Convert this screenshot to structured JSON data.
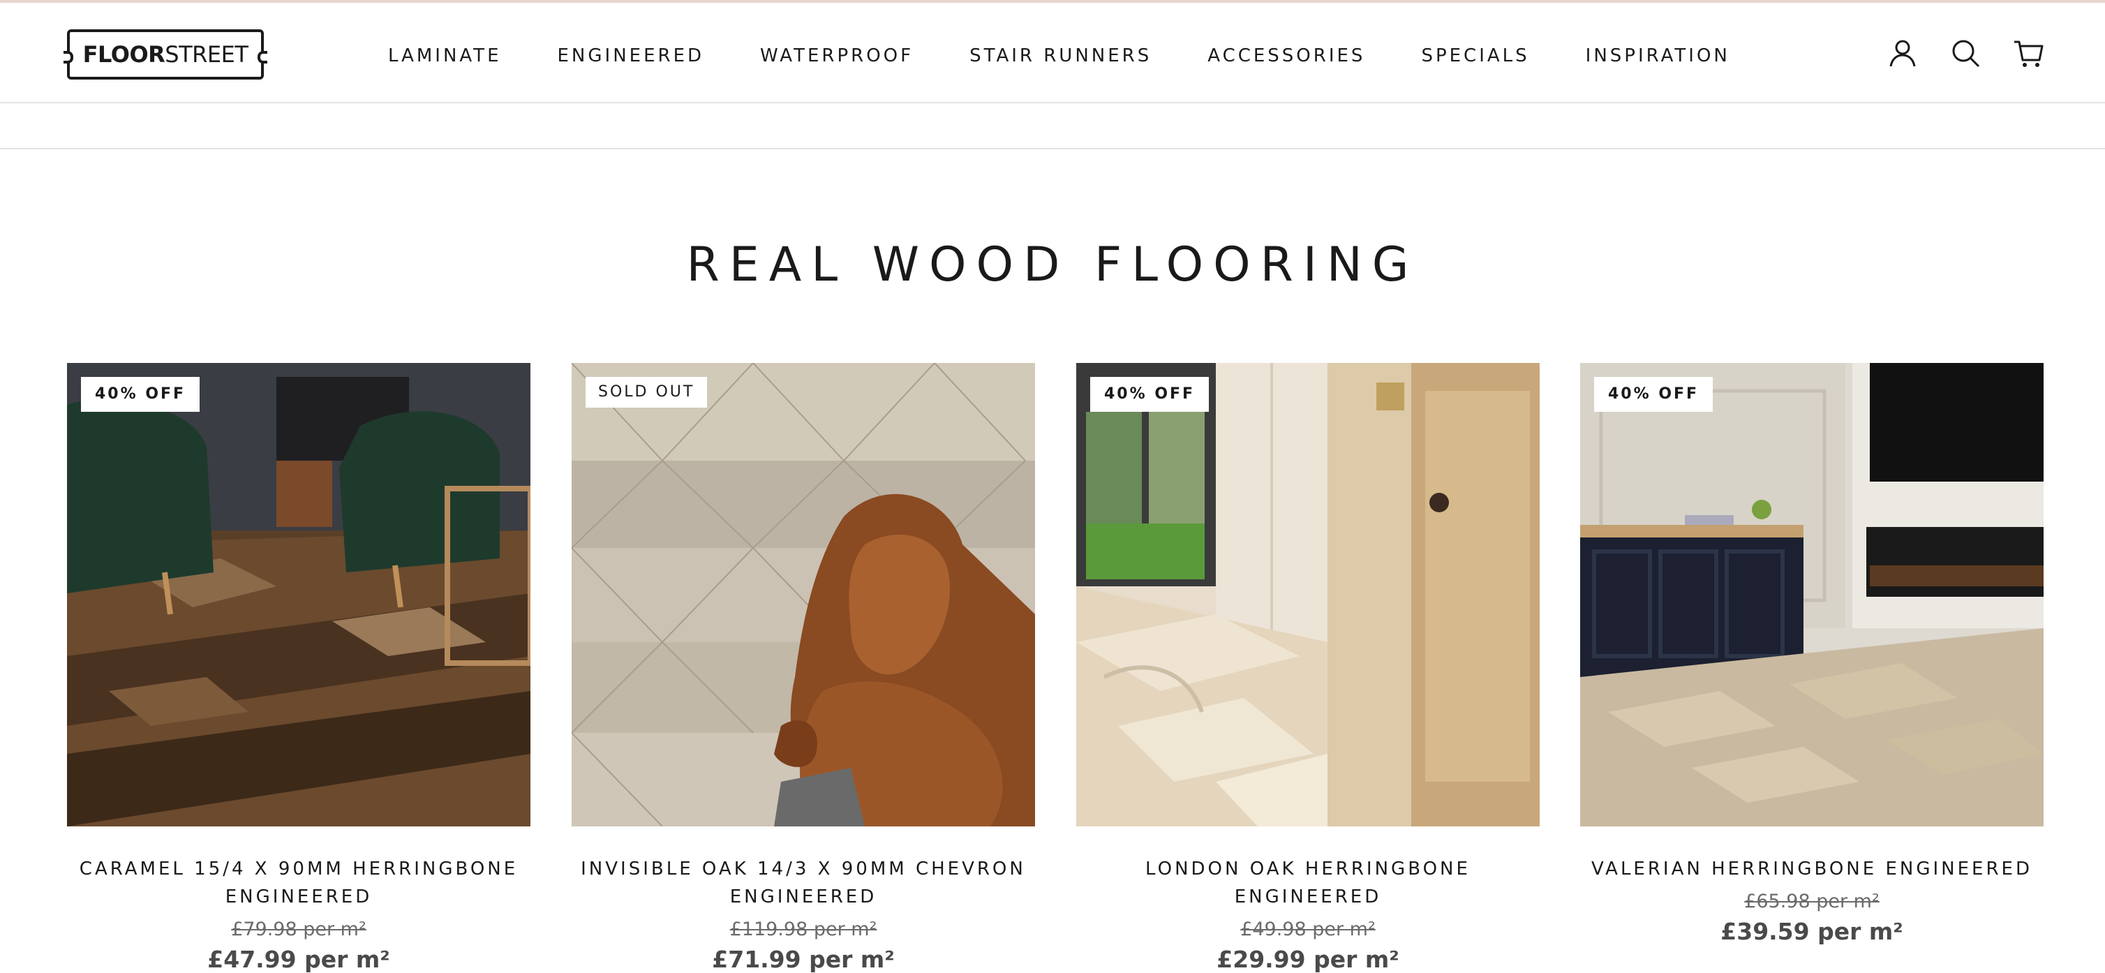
{
  "brand": {
    "bold": "FLOOR",
    "light": "STREET"
  },
  "nav": [
    {
      "label": "LAMINATE"
    },
    {
      "label": "ENGINEERED"
    },
    {
      "label": "WATERPROOF"
    },
    {
      "label": "STAIR RUNNERS"
    },
    {
      "label": "ACCESSORIES"
    },
    {
      "label": "SPECIALS"
    },
    {
      "label": "INSPIRATION"
    }
  ],
  "icons": [
    "account-icon",
    "search-icon",
    "cart-icon"
  ],
  "page_title": "REAL WOOD FLOORING",
  "products": [
    {
      "badge": "40% OFF",
      "title": "CARAMEL 15/4 X 90MM HERRINGBONE ENGINEERED",
      "was": "£79.98 per m²",
      "now": "£47.99 per m²"
    },
    {
      "badge": "SOLD OUT",
      "title": "INVISIBLE OAK 14/3 X 90MM CHEVRON ENGINEERED",
      "was": "£119.98 per m²",
      "now": "£71.99 per m²"
    },
    {
      "badge": "40% OFF",
      "title": "LONDON OAK HERRINGBONE ENGINEERED",
      "was": "£49.98 per m²",
      "now": "£29.99 per m²"
    },
    {
      "badge": "40% OFF",
      "title": "VALERIAN HERRINGBONE ENGINEERED",
      "was": "£65.98 per m²",
      "now": "£39.59 per m²"
    }
  ]
}
